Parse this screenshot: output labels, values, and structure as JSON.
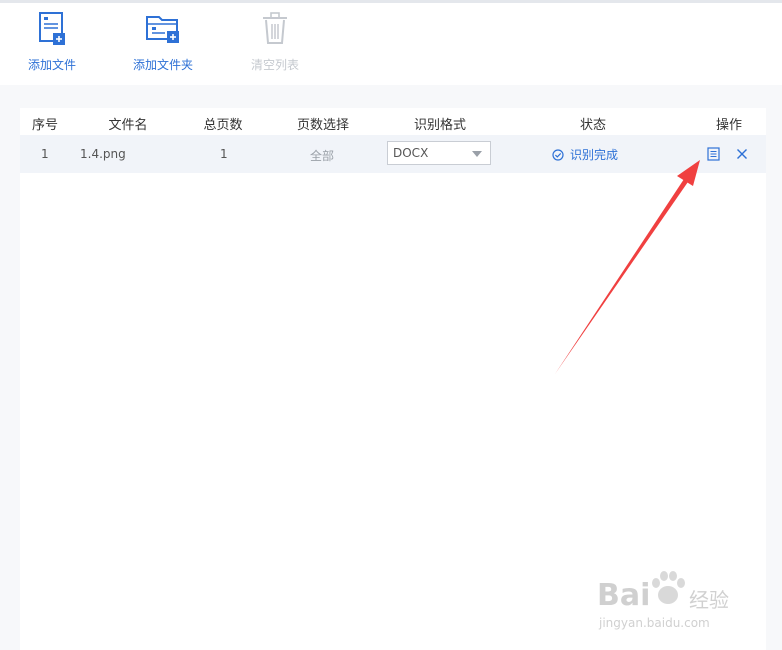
{
  "toolbar": {
    "add_file": "添加文件",
    "add_folder": "添加文件夹",
    "clear_list": "清空列表"
  },
  "table": {
    "headers": [
      "序号",
      "文件名",
      "总页数",
      "页数选择",
      "识别格式",
      "状态",
      "操作"
    ],
    "rows": [
      {
        "index": "1",
        "filename": "1.4.png",
        "total_pages": "1",
        "page_selection": "全部",
        "format": "DOCX",
        "status": "识别完成"
      }
    ]
  },
  "watermark": {
    "brand": "Bai",
    "brand_suffix": "经验",
    "url": "jingyan.baidu.com"
  },
  "colors": {
    "accent": "#2e71d6",
    "arrow": "#f04040",
    "row_bg": "#f1f4f9",
    "page_bg": "#f7f8fa"
  },
  "icons": [
    "add-file-icon",
    "add-folder-icon",
    "trash-icon",
    "check-circle-icon",
    "document-icon",
    "close-icon",
    "paw-icon"
  ]
}
